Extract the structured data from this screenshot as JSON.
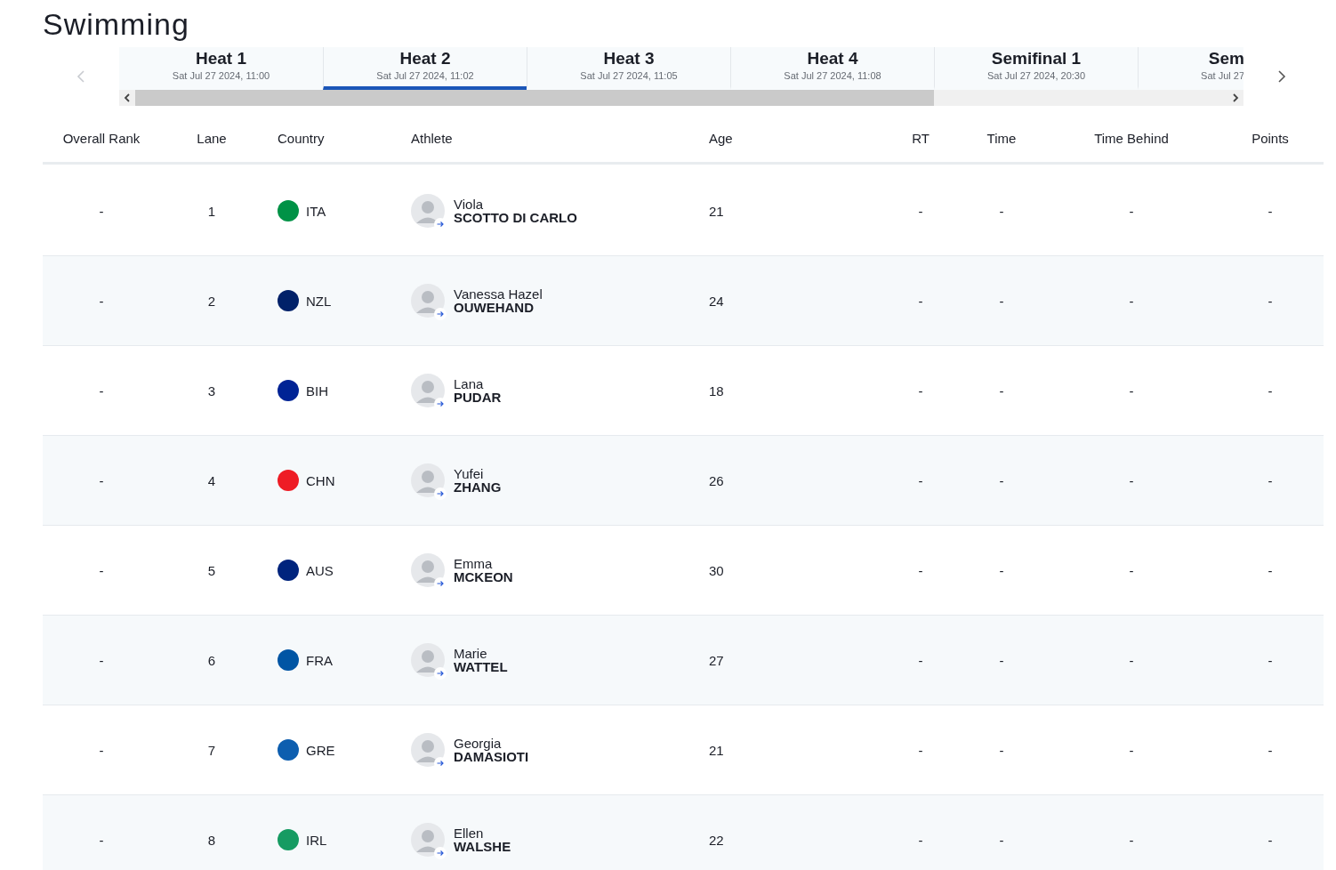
{
  "title": "Swimming",
  "tabs": [
    {
      "label": "Heat 1",
      "date": "Sat Jul 27 2024, 11:00",
      "selected": false
    },
    {
      "label": "Heat 2",
      "date": "Sat Jul 27 2024, 11:02",
      "selected": true
    },
    {
      "label": "Heat 3",
      "date": "Sat Jul 27 2024, 11:05",
      "selected": false
    },
    {
      "label": "Heat 4",
      "date": "Sat Jul 27 2024, 11:08",
      "selected": false
    },
    {
      "label": "Semifinal 1",
      "date": "Sat Jul 27 2024, 20:30",
      "selected": false
    },
    {
      "label": "Sem",
      "date": "Sat Jul 27",
      "selected": false
    }
  ],
  "columns": [
    "Overall Rank",
    "Lane",
    "Country",
    "Athlete",
    "Age",
    "RT",
    "Time",
    "Time Behind",
    "Points"
  ],
  "rows": [
    {
      "rank": "-",
      "lane": "1",
      "country": "ITA",
      "color": "#009246",
      "first_name": "Viola",
      "last_name": "SCOTTO DI CARLO",
      "age": "21",
      "rt": "-",
      "time": "-",
      "time_behind": "-",
      "points": "-"
    },
    {
      "rank": "-",
      "lane": "2",
      "country": "NZL",
      "color": "#012169",
      "first_name": "Vanessa Hazel",
      "last_name": "OUWEHAND",
      "age": "24",
      "rt": "-",
      "time": "-",
      "time_behind": "-",
      "points": "-"
    },
    {
      "rank": "-",
      "lane": "3",
      "country": "BIH",
      "color": "#002395",
      "first_name": "Lana",
      "last_name": "PUDAR",
      "age": "18",
      "rt": "-",
      "time": "-",
      "time_behind": "-",
      "points": "-"
    },
    {
      "rank": "-",
      "lane": "4",
      "country": "CHN",
      "color": "#ee1c25",
      "first_name": "Yufei",
      "last_name": "ZHANG",
      "age": "26",
      "rt": "-",
      "time": "-",
      "time_behind": "-",
      "points": "-"
    },
    {
      "rank": "-",
      "lane": "5",
      "country": "AUS",
      "color": "#00247d",
      "first_name": "Emma",
      "last_name": "MCKEON",
      "age": "30",
      "rt": "-",
      "time": "-",
      "time_behind": "-",
      "points": "-"
    },
    {
      "rank": "-",
      "lane": "6",
      "country": "FRA",
      "color": "#0055a4",
      "first_name": "Marie",
      "last_name": "WATTEL",
      "age": "27",
      "rt": "-",
      "time": "-",
      "time_behind": "-",
      "points": "-"
    },
    {
      "rank": "-",
      "lane": "7",
      "country": "GRE",
      "color": "#0d5eaf",
      "first_name": "Georgia",
      "last_name": "DAMASIOTI",
      "age": "21",
      "rt": "-",
      "time": "-",
      "time_behind": "-",
      "points": "-"
    },
    {
      "rank": "-",
      "lane": "8",
      "country": "IRL",
      "color": "#169b62",
      "first_name": "Ellen",
      "last_name": "WALSHE",
      "age": "22",
      "rt": "-",
      "time": "-",
      "time_behind": "-",
      "points": "-"
    }
  ]
}
